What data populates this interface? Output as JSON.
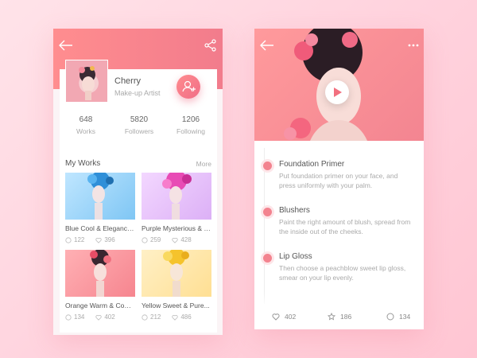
{
  "profile": {
    "name": "Cherry",
    "role": "Make-up Artist",
    "stats": [
      {
        "value": "648",
        "label": "Works"
      },
      {
        "value": "5820",
        "label": "Followers"
      },
      {
        "value": "1206",
        "label": "Following"
      }
    ]
  },
  "works": {
    "title": "My Works",
    "more_label": "More",
    "items": [
      {
        "title": "Blue Cool & Elegance...",
        "comments": "122",
        "likes": "396"
      },
      {
        "title": "Purple Mysterious & m...",
        "comments": "259",
        "likes": "428"
      },
      {
        "title": "Orange Warm & Comf...",
        "comments": "134",
        "likes": "402"
      },
      {
        "title": "Yellow Sweet & Pure...",
        "comments": "212",
        "likes": "486"
      }
    ]
  },
  "tutorial": {
    "steps": [
      {
        "name": "Foundation Primer",
        "desc": "Put foundation primer on your face, and press uniformly with your palm."
      },
      {
        "name": "Blushers",
        "desc": "Paint the right amount of blush, spread from the inside out of the cheeks."
      },
      {
        "name": "Lip Gloss",
        "desc": "Then choose a peachblow sweet lip gloss, smear on your lip evenly."
      }
    ]
  },
  "bottom_bar": {
    "likes": "402",
    "stars": "186",
    "comments": "134"
  },
  "colors": {
    "accent": "#f27c8c",
    "background": "#ffd9e1"
  }
}
